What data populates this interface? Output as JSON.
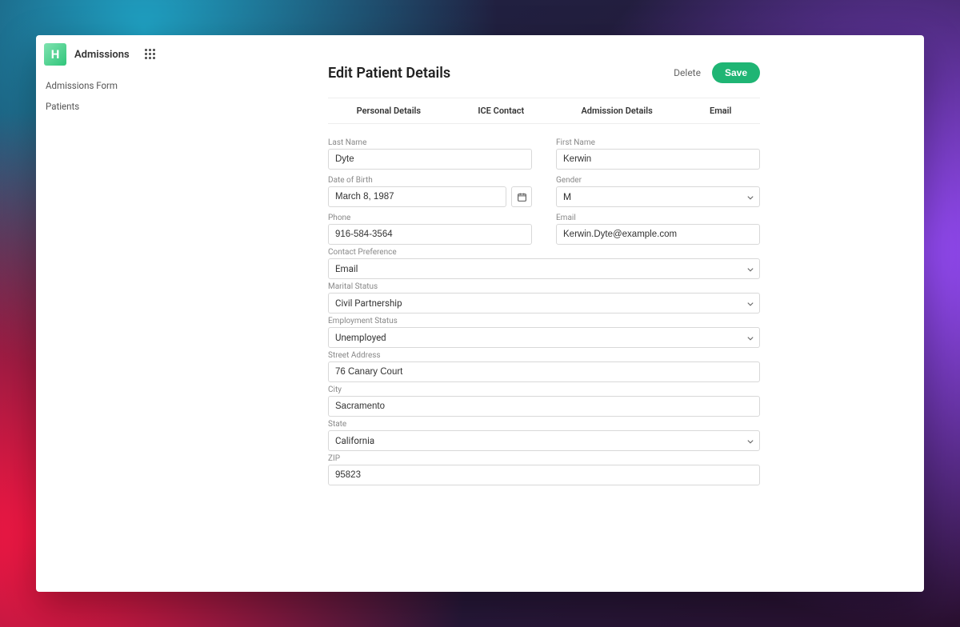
{
  "brand": {
    "logo_letter": "H",
    "title": "Admissions"
  },
  "nav": {
    "items": [
      "Admissions Form",
      "Patients"
    ]
  },
  "header": {
    "title": "Edit Patient Details",
    "delete": "Delete",
    "save": "Save"
  },
  "tabs": [
    "Personal Details",
    "ICE Contact",
    "Admission Details",
    "Email"
  ],
  "labels": {
    "last_name": "Last Name",
    "first_name": "First Name",
    "dob": "Date of Birth",
    "gender": "Gender",
    "phone": "Phone",
    "email": "Email",
    "contact_pref": "Contact Preference",
    "marital": "Marital Status",
    "employment": "Employment Status",
    "street": "Street Address",
    "city": "City",
    "state": "State",
    "zip": "ZIP"
  },
  "values": {
    "last_name": "Dyte",
    "first_name": "Kerwin",
    "dob": "March 8, 1987",
    "gender": "M",
    "phone": "916-584-3564",
    "email": "Kerwin.Dyte@example.com",
    "contact_pref": "Email",
    "marital": "Civil Partnership",
    "employment": "Unemployed",
    "street": "76 Canary Court",
    "city": "Sacramento",
    "state": "California",
    "zip": "95823"
  }
}
